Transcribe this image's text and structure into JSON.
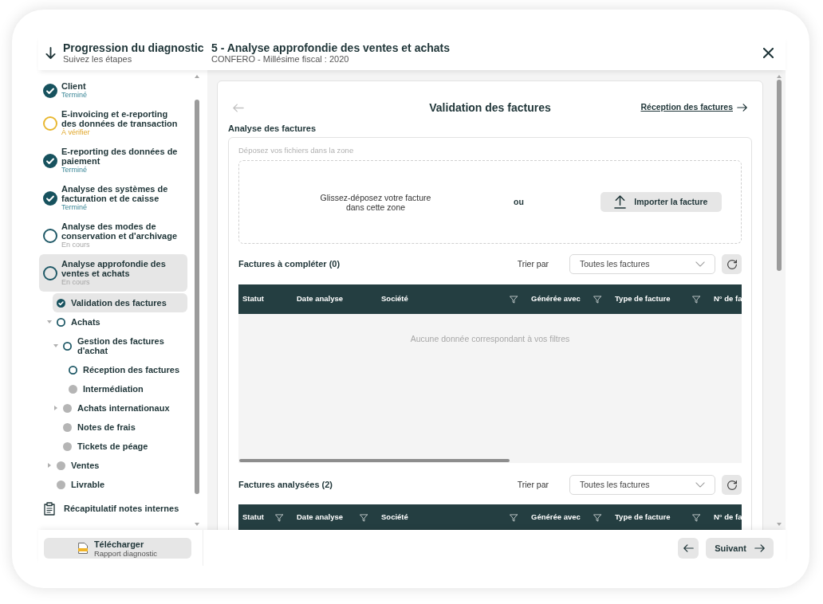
{
  "sidebar": {
    "title": "Progression du diagnostic",
    "subtitle": "Suivez les étapes",
    "steps": [
      {
        "label": "Client",
        "kind": "done",
        "status": "Terminé",
        "selected": false
      },
      {
        "label": "E-invoicing et e-reporting des données de transaction",
        "kind": "warning",
        "status": "À vérifier",
        "selected": false
      },
      {
        "label": "E-reporting des données de paiement",
        "kind": "done",
        "status": "Terminé",
        "selected": false
      },
      {
        "label": "Analyse des systèmes de facturation et de caisse",
        "kind": "done",
        "status": "Terminé",
        "selected": false
      },
      {
        "label": "Analyse des modes de conservation et d'archivage",
        "kind": "in_progress",
        "status": "En cours",
        "selected": false
      },
      {
        "label": "Analyse approfondie des ventes et achats",
        "kind": "in_progress",
        "status": "En cours",
        "selected": true,
        "children": [
          {
            "label": "Validation des factures",
            "kind": "done",
            "selected": true
          },
          {
            "label": "Achats",
            "kind": "in_progress",
            "selected": false,
            "expanded": true,
            "children": [
              {
                "label": "Gestion des factures d'achat",
                "kind": "in_progress",
                "selected": false,
                "expanded": true,
                "children": [
                  {
                    "label": "Réception des factures",
                    "kind": "in_progress",
                    "selected": false
                  },
                  {
                    "label": "Intermédiation",
                    "kind": "pending",
                    "selected": false
                  }
                ]
              },
              {
                "label": "Achats internationaux",
                "kind": "pending",
                "selected": false,
                "expanded": false
              },
              {
                "label": "Notes de frais",
                "kind": "pending",
                "selected": false
              },
              {
                "label": "Tickets de péage",
                "kind": "pending",
                "selected": false
              }
            ]
          },
          {
            "label": "Ventes",
            "kind": "pending",
            "selected": false,
            "expanded": false
          },
          {
            "label": "Livrable",
            "kind": "pending",
            "selected": false
          }
        ]
      }
    ],
    "notes_link": "Récapitulatif notes internes"
  },
  "header": {
    "title": "5 - Analyse approfondie des ventes et achats",
    "subtitle": "CONFERO - Millésime fiscal : 2020"
  },
  "content": {
    "title": "Validation des factures",
    "next_link": "Réception des factures",
    "section_title": "Analyse des factures",
    "dropzone": {
      "hint": "Déposez vos fichiers dans la zone",
      "drag_text": "Glissez-déposez votre facture dans cette zone",
      "or_text": "ou",
      "import_button": "Importer la facture"
    },
    "tables": [
      {
        "title": "Factures à compléter (0)",
        "sort_label": "Trier par",
        "sort_value": "Toutes les factures",
        "columns": [
          {
            "label": "Statut",
            "filter": false
          },
          {
            "label": "Date analyse",
            "filter": false
          },
          {
            "label": "Société",
            "filter": true
          },
          {
            "label": "Générée avec",
            "filter": true
          },
          {
            "label": "Type de facture",
            "filter": true
          },
          {
            "label": "N° de fa",
            "filter": false
          }
        ],
        "empty_text": "Aucune donnée correspondant à vos filtres"
      },
      {
        "title": "Factures analysées (2)",
        "sort_label": "Trier par",
        "sort_value": "Toutes les factures",
        "columns": [
          {
            "label": "Statut",
            "filter": true
          },
          {
            "label": "Date analyse",
            "filter": true
          },
          {
            "label": "Société",
            "filter": true
          },
          {
            "label": "Générée avec",
            "filter": true
          },
          {
            "label": "Type de facture",
            "filter": true
          },
          {
            "label": "N° de fa",
            "filter": false
          }
        ]
      }
    ]
  },
  "footer": {
    "download_button": {
      "label": "Télécharger",
      "sublabel": "Rapport diagnostic"
    },
    "next_button": "Suivant"
  }
}
